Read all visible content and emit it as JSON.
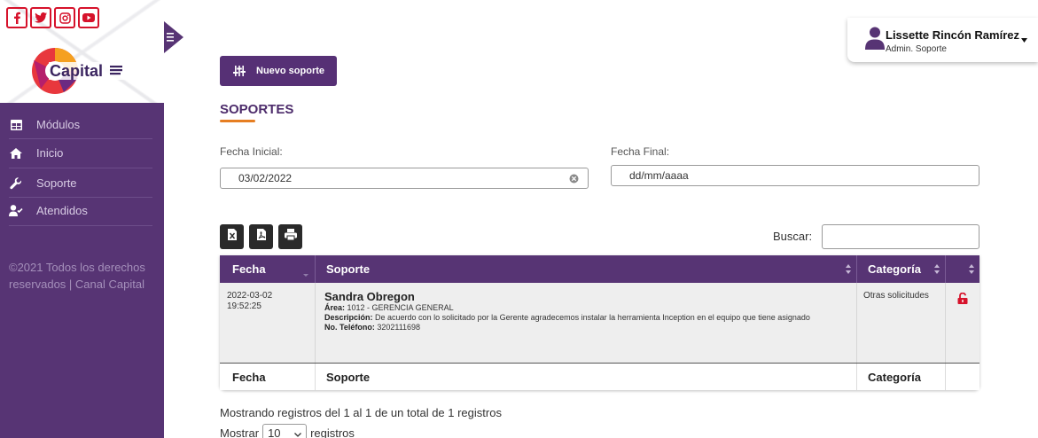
{
  "sidebar": {
    "social": [
      "facebook",
      "twitter",
      "instagram",
      "youtube"
    ],
    "logo_text": "Capital",
    "menu": [
      {
        "label": "Módulos",
        "icon": "grid-icon"
      },
      {
        "label": "Inicio",
        "icon": "home-icon"
      },
      {
        "label": "Soporte",
        "icon": "wrench-icon"
      },
      {
        "label": "Atendidos",
        "icon": "user-check-icon"
      }
    ],
    "copyright": "©2021 Todos los derechos reservados | Canal Capital"
  },
  "user": {
    "name": "Lissette Rincón Ramírez",
    "role": "Admin. Soporte"
  },
  "toolbar": {
    "new_support_label": "Nuevo soporte"
  },
  "page": {
    "title": "SOPORTES"
  },
  "filters": {
    "start_label": "Fecha Inicial:",
    "start_value": "03/02/2022",
    "end_label": "Fecha Final:",
    "end_placeholder": "dd/mm/aaaa"
  },
  "search": {
    "label": "Buscar:"
  },
  "table": {
    "headers": [
      "Fecha",
      "Soporte",
      "Categoría",
      ""
    ],
    "footers": [
      "Fecha",
      "Soporte",
      "Categoría"
    ],
    "rows": [
      {
        "date": "2022-03-02",
        "time": "19:52:25",
        "name": "Sandra Obregon",
        "area_label": "Área:",
        "area": "1012 - GERENCIA GENERAL",
        "desc_label": "Descripción:",
        "desc": "De acuerdo con lo solicitado por la Gerente agradecemos instalar la herramienta Inception en el equipo que tiene asignado",
        "phone_label": "No. Teléfono:",
        "phone": "3202111698",
        "category": "Otras solicitudes"
      }
    ]
  },
  "pagination": {
    "info": "Mostrando registros del 1 al 1 de un total de 1 registros",
    "show_label": "Mostrar",
    "page_size": "10",
    "records_label": "registros"
  },
  "colors": {
    "primary": "#573474",
    "accent": "#e67e22",
    "danger": "#d6122b"
  }
}
